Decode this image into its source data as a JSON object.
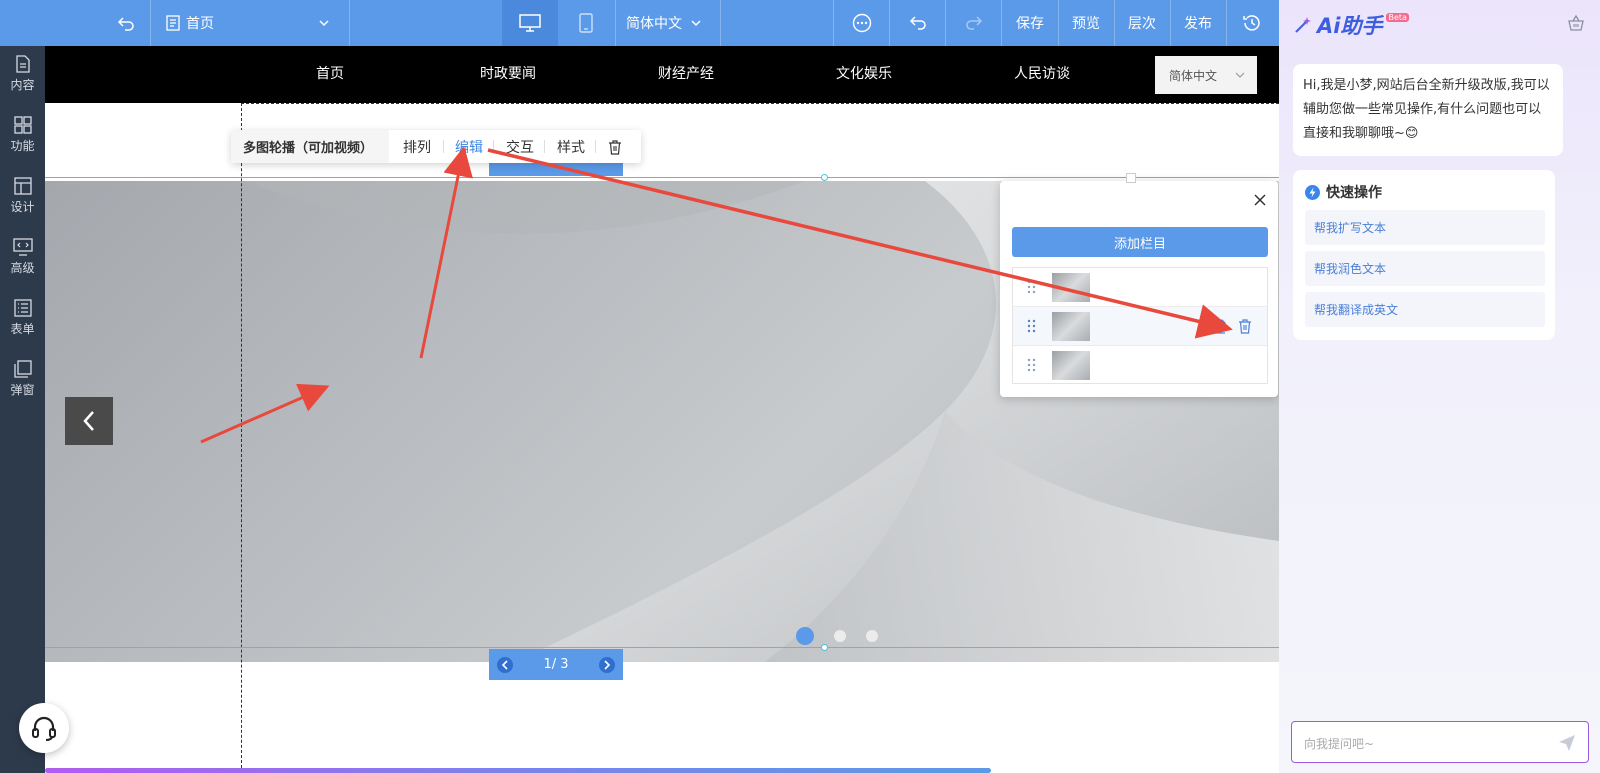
{
  "topbar": {
    "page_select": "首页",
    "language_select": "简体中文",
    "save": "保存",
    "preview": "预览",
    "layers": "层次",
    "publish": "发布"
  },
  "sidebar": {
    "items": [
      {
        "label": "内容",
        "icon": "document-icon"
      },
      {
        "label": "功能",
        "icon": "grid-icon"
      },
      {
        "label": "设计",
        "icon": "layout-icon"
      },
      {
        "label": "高级",
        "icon": "code-monitor-icon"
      },
      {
        "label": "表单",
        "icon": "form-list-icon"
      },
      {
        "label": "弹窗",
        "icon": "popup-layers-icon"
      }
    ]
  },
  "site_nav": {
    "items": [
      "首页",
      "时政要闻",
      "财经产经",
      "文化娱乐",
      "人民访谈"
    ],
    "language": "简体中文"
  },
  "component_toolbar": {
    "name": "多图轮播（可加视频）",
    "arrange": "排列",
    "edit": "编辑",
    "interact": "交互",
    "style": "样式"
  },
  "carousel": {
    "pager_text": "1/ 3",
    "current_slide": 1,
    "slide_count": 3
  },
  "slide_popup": {
    "add_column": "添加栏目",
    "rows": 3,
    "active_row": 2
  },
  "ai_panel": {
    "logo_text": "Ai助手",
    "beta_badge": "Beta",
    "greeting": "Hi,我是小梦,网站后台全新升级改版,我可以辅助您做一些常见操作,有什么问题也可以直接和我聊聊哦~😊",
    "quick_title": "快速操作",
    "quick_actions": [
      "帮我扩写文本",
      "帮我润色文本",
      "帮我翻译成英文"
    ],
    "input_placeholder": "向我提问吧~"
  },
  "colors": {
    "topbar": "#5b9ae8",
    "sidebar": "#2d3a4b",
    "annotation_arrow": "#e8493c",
    "selection": "#3fc7e3",
    "ai_accent": "#9b5be0"
  }
}
